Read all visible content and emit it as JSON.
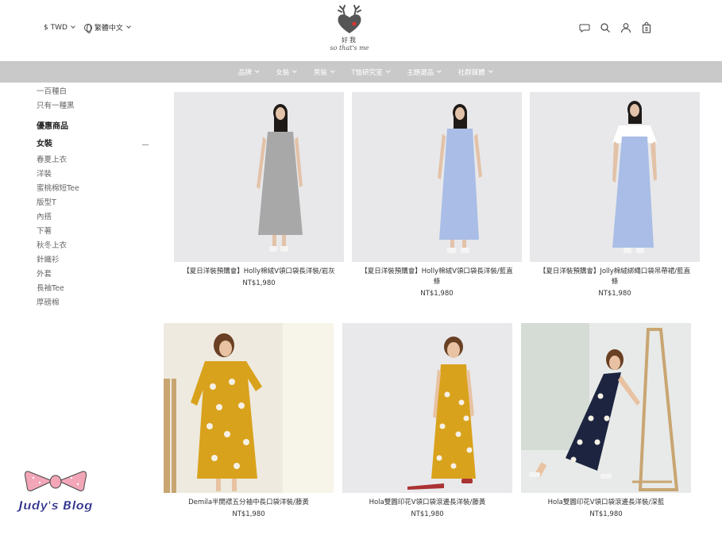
{
  "header": {
    "currency": "$ TWD",
    "language": "繁體中文",
    "logo_char": "好我",
    "logo_tagline": "so that's me"
  },
  "nav": {
    "items": [
      "品牌",
      "女裝",
      "男裝",
      "T恤研究室",
      "主題選品",
      "社群媒體"
    ]
  },
  "sidebar": {
    "top_items": [
      "一百種白",
      "只有一種黑"
    ],
    "sale": "優惠商品",
    "women": "女裝",
    "women_items": [
      "春夏上衣",
      "洋裝",
      "蜜桃棉短Tee",
      "版型T",
      "內搭",
      "下著",
      "秋冬上衣",
      "針織衫",
      "外套",
      "長袖Tee",
      "厚磅棉"
    ]
  },
  "products": [
    {
      "name": "【夏日洋裝預購會】Holly棉絨V領口袋長洋裝/岩灰",
      "price": "NT$1,980"
    },
    {
      "name": "【夏日洋裝預購會】Holly棉絨V領口袋長洋裝/藍直條",
      "price": "NT$1,980"
    },
    {
      "name": "【夏日洋裝預購會】Jolly棉絨綁繩口袋吊帶裙/藍直條",
      "price": "NT$1,980"
    },
    {
      "name": "Demila半開襟五分袖中長口袋洋裝/藤黃",
      "price": "NT$1,980"
    },
    {
      "name": "Hola雙圓印花V領口袋滾邊長洋裝/藤黃",
      "price": "NT$1,980"
    },
    {
      "name": "Hola雙圓印花V領口袋滾邊長洋裝/深藍",
      "price": "NT$1,980"
    }
  ],
  "watermark": {
    "text": "Judy's Blog"
  },
  "colors": {
    "nav_bg": "#c9c9c9",
    "mustard": "#d9a21c",
    "navy": "#1d2440",
    "lightblue": "#a9bde6",
    "grey_dress": "#a8a8a8"
  }
}
